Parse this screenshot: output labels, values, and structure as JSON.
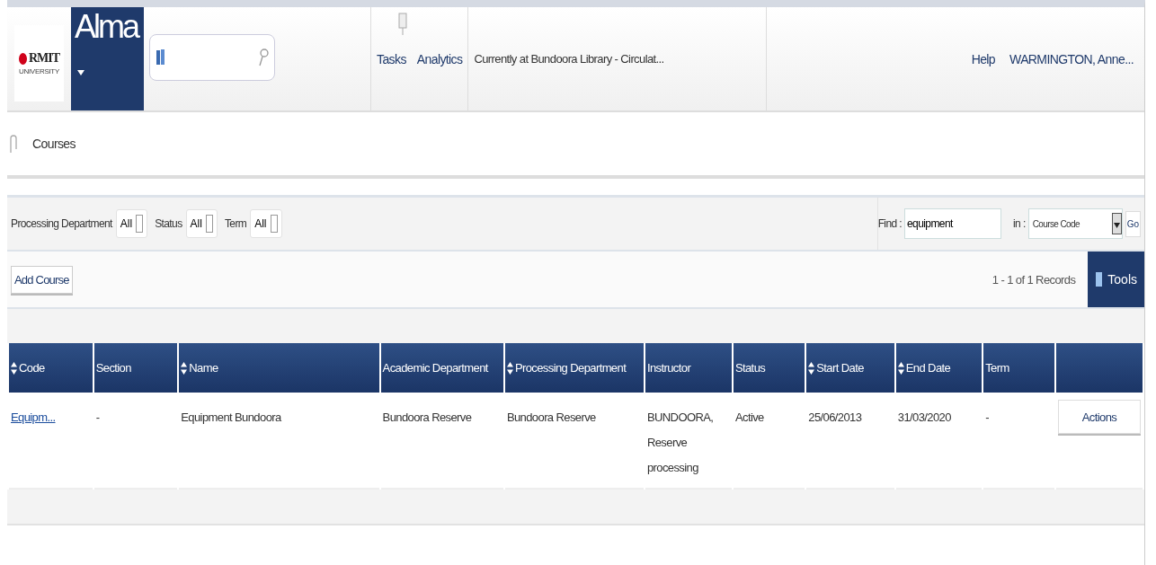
{
  "logo": {
    "name": "RMIT",
    "subtitle": "UNIVERSITY"
  },
  "app_menu": {
    "label": "Alma"
  },
  "nav": [
    {
      "label": "Tasks"
    },
    {
      "label": "Analytics"
    }
  ],
  "location": "Currently at Bundoora Library - Circulat...",
  "help": "Help",
  "user": "WARMINGTON, Anne...",
  "breadcrumb": "Courses",
  "filters": [
    {
      "label": "Processing Department",
      "value": "All"
    },
    {
      "label": "Status",
      "value": "All"
    },
    {
      "label": "Term",
      "value": "All"
    }
  ],
  "find": {
    "label": "Find :",
    "value": "equipment",
    "in_label": "in :",
    "in_value": "Course Code",
    "go": "Go"
  },
  "add_button": "Add Course",
  "records": "1 - 1 of 1 Records",
  "tools": "Tools",
  "table": {
    "columns": [
      {
        "label": "Code",
        "sortable": true
      },
      {
        "label": "Section",
        "sortable": false
      },
      {
        "label": "Name",
        "sortable": true
      },
      {
        "label": "Academic Department",
        "sortable": false
      },
      {
        "label": "Processing Department",
        "sortable": true
      },
      {
        "label": "Instructor",
        "sortable": false
      },
      {
        "label": "Status",
        "sortable": false
      },
      {
        "label": "Start Date",
        "sortable": true
      },
      {
        "label": "End Date",
        "sortable": true
      },
      {
        "label": "Term",
        "sortable": false
      }
    ],
    "rows": [
      {
        "cells": [
          "Equipm...",
          "-",
          "Equipment Bundoora",
          "Bundoora Reserve",
          "Bundoora Reserve",
          "BUNDOORA, Reserve processing",
          "Active",
          "25/06/2013",
          "31/03/2020",
          "-"
        ],
        "action": "Actions"
      }
    ]
  }
}
